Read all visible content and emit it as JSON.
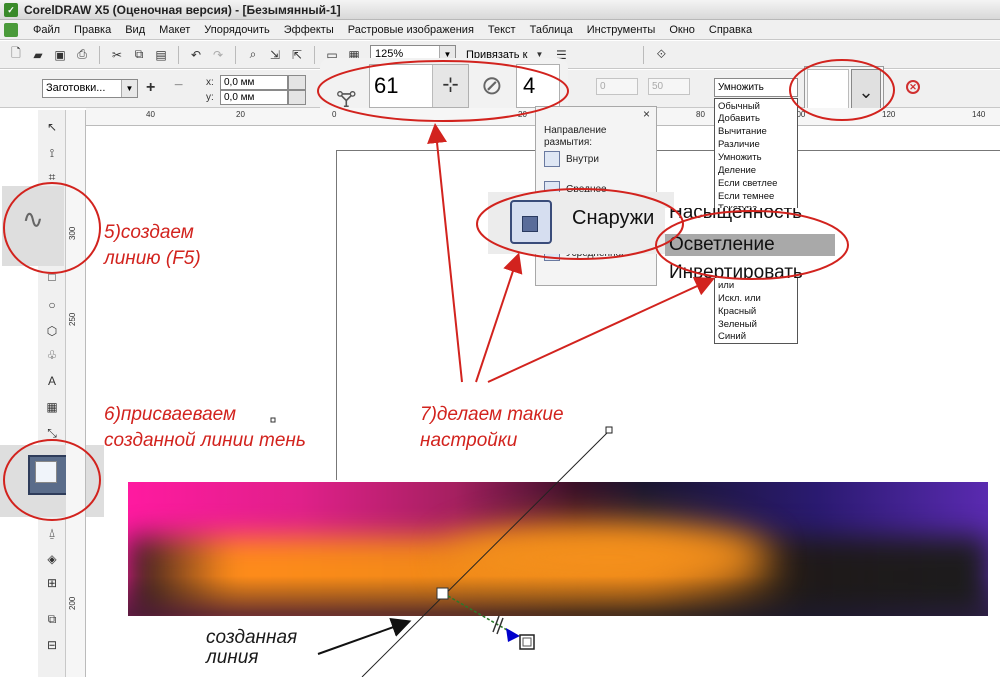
{
  "window": {
    "title": "CorelDRAW X5 (Оценочная версия) - [Безымянный-1]"
  },
  "menu": {
    "items": [
      "Файл",
      "Правка",
      "Вид",
      "Макет",
      "Упорядочить",
      "Эффекты",
      "Растровые изображения",
      "Текст",
      "Таблица",
      "Инструменты",
      "Окно",
      "Справка"
    ]
  },
  "toolbar": {
    "zoom": "125%",
    "snap_label": "Привязать к"
  },
  "propbar": {
    "preset": "Заготовки...",
    "x_label": "x:",
    "x_value": "0,0 мм",
    "y_label": "y:",
    "y_value": "0,0 мм",
    "opacity": "61",
    "feather": "4",
    "dim1": "0",
    "dim2": "50",
    "merge_mode": "Умножить"
  },
  "rulers": {
    "h_ticks": [
      "40",
      "20",
      "0",
      "20",
      "80",
      "100",
      "120",
      "140"
    ],
    "v_ticks": [
      "300",
      "250",
      "200"
    ]
  },
  "feather_dialog": {
    "caption_line1": "Направление",
    "caption_line2": "размытия:",
    "option_inside": "Внутри",
    "option_middle": "Среднее",
    "option_average": "Усредненное",
    "option_outside": "Снаружи",
    "close": "×"
  },
  "blend_list": {
    "items_top": [
      "Обычный",
      "Добавить",
      "Вычитание",
      "Различие",
      "Умножить",
      "Деление",
      "Если светлее",
      "Если темнее",
      "Текстура"
    ],
    "items_bottom": [
      "или",
      "Искл. или",
      "Красный",
      "Зеленый",
      "Синий"
    ],
    "zoom_prev": "Насыщенность",
    "zoom_selected": "Осветление",
    "zoom_next": "Инвертировать"
  },
  "annotations": {
    "step5_line1": "5)создаем",
    "step5_line2": "линию (F5)",
    "step6_line1": "6)присваеваем",
    "step6_line2": "созданной линии тень",
    "step7_line1": "7)делаем такие",
    "step7_line2": "настройки",
    "created_line1": "созданная",
    "created_line2": "линия"
  },
  "colors": {
    "annotation_red": "#d2231e",
    "magenta": "#ff1aa0",
    "orange": "#f08818",
    "purple": "#5a2ab0",
    "handle_blue": "#0000cc"
  }
}
